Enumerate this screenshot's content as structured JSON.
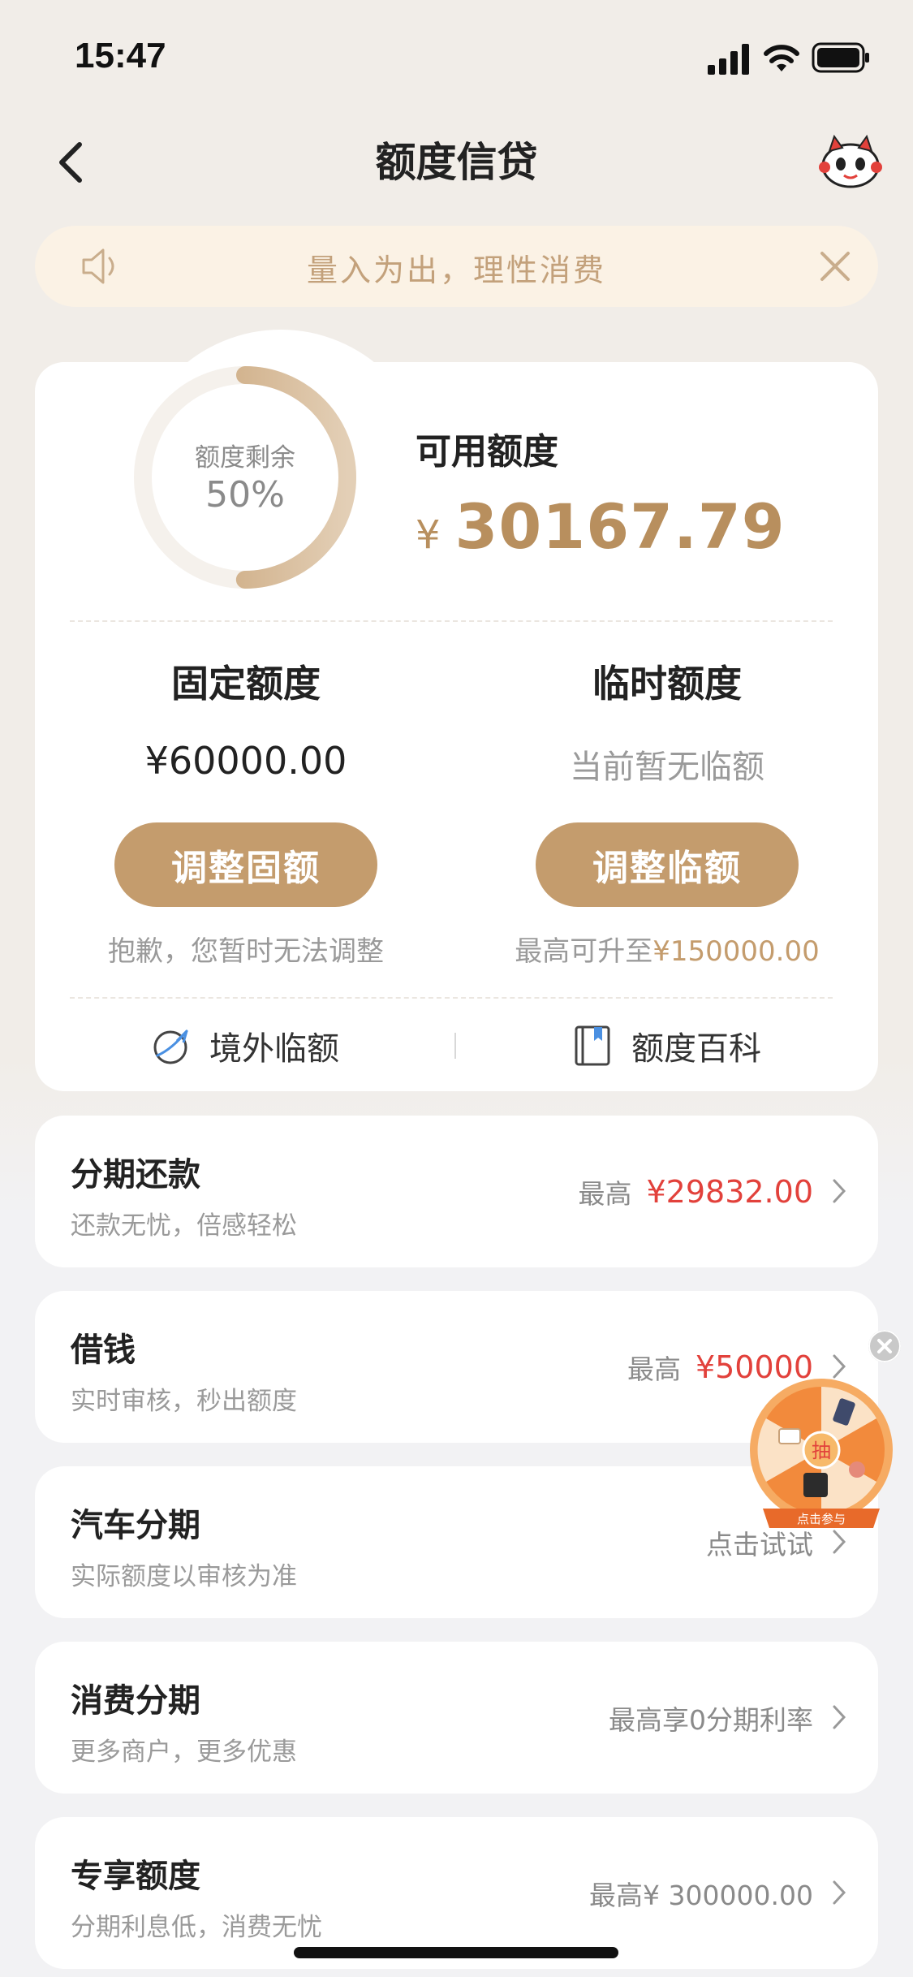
{
  "status_bar": {
    "time": "15:47"
  },
  "nav": {
    "title": "额度信贷"
  },
  "notice": {
    "text": "量入为出，理性消费"
  },
  "credit": {
    "ring_label": "额度剩余",
    "ring_value": "50%",
    "ring_fraction": 0.5,
    "available_label": "可用额度",
    "currency": "¥",
    "available_amount": "30167.79",
    "fixed": {
      "title": "固定额度",
      "value": "¥60000.00",
      "button": "调整固额",
      "note": "抱歉，您暂时无法调整"
    },
    "temp": {
      "title": "临时额度",
      "value": "当前暂无临额",
      "button": "调整临额",
      "note_prefix": "最高可升至",
      "note_amount": "¥150000.00"
    },
    "links": {
      "overseas": "境外临额",
      "wiki": "额度百科"
    }
  },
  "products": [
    {
      "title": "分期还款",
      "subtitle": "还款无忧，倍感轻松",
      "prefix": "最高",
      "amount": "¥29832.00"
    },
    {
      "title": "借钱",
      "subtitle": "实时审核，秒出额度",
      "prefix": "最高",
      "amount": "¥50000"
    },
    {
      "title": "汽车分期",
      "subtitle": "实际额度以审核为准",
      "action": "点击试试"
    },
    {
      "title": "消费分期",
      "subtitle": "更多商户，更多优惠",
      "action": "最高享0分期利率"
    },
    {
      "title": "专享额度",
      "subtitle": "分期利息低，消费无忧",
      "action": "最高¥ 300000.00"
    }
  ],
  "lottery": {
    "center": "抽",
    "caption": "点击参与"
  },
  "colors": {
    "gold": "#c49c6d",
    "gold_text": "#b88f5e",
    "red": "#e2413b",
    "notice_bg": "#fbf2e5"
  }
}
